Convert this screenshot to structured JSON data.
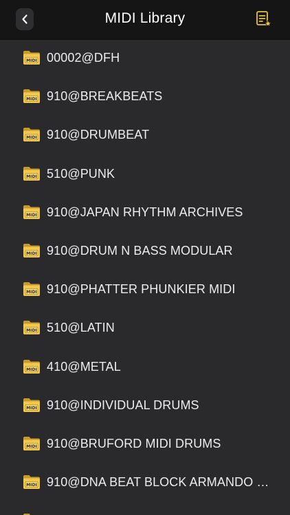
{
  "header": {
    "title": "MIDI Library",
    "back_icon": "chevron-left-icon",
    "favorites_icon": "list-star-icon"
  },
  "colors": {
    "header_bg": "#151515",
    "list_bg": "#2a2a2c",
    "folder_gold": "#e8c04a",
    "text": "#ededed"
  },
  "folder_badge": "MIDI",
  "items": [
    {
      "label": "00002@DFH"
    },
    {
      "label": "910@BREAKBEATS"
    },
    {
      "label": "910@DRUMBEAT"
    },
    {
      "label": "510@PUNK"
    },
    {
      "label": "910@JAPAN RHYTHM ARCHIVES"
    },
    {
      "label": "910@DRUM N BASS MODULAR"
    },
    {
      "label": "910@PHATTER PHUNKIER MIDI"
    },
    {
      "label": "510@LATIN"
    },
    {
      "label": "410@METAL"
    },
    {
      "label": "910@INDIVIDUAL DRUMS"
    },
    {
      "label": "910@BRUFORD MIDI DRUMS"
    },
    {
      "label": "910@DNA BEAT BLOCK ARMANDO B..."
    },
    {
      "label": ""
    }
  ]
}
